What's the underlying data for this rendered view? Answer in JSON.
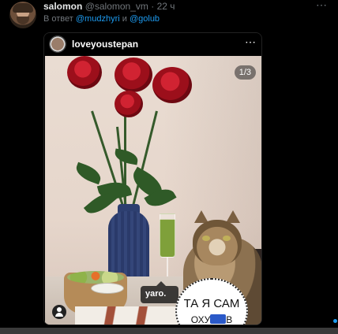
{
  "tweet": {
    "author_name": "salomon",
    "author_handle": "@salomon_vm",
    "separator": "·",
    "time": "22 ч",
    "reply_prefix": "В ответ",
    "mention_1": "@mudzhyri",
    "conjunction": "и",
    "mention_2": "@golub",
    "more_icon": "⋯"
  },
  "instagram_embed": {
    "username": "loveyoustepan",
    "more_icon": "⋯",
    "slide_counter": "1/3",
    "tag_label": "yaro.",
    "sticker_line1": "ТА Я САМ",
    "sticker_line2_prefix": "ОХУ",
    "sticker_line2_suffix": "В",
    "user_tag_icon": "person-icon"
  },
  "colors": {
    "background": "#000000",
    "accent_blue": "#1d9bf0",
    "muted_text": "#71767b"
  }
}
